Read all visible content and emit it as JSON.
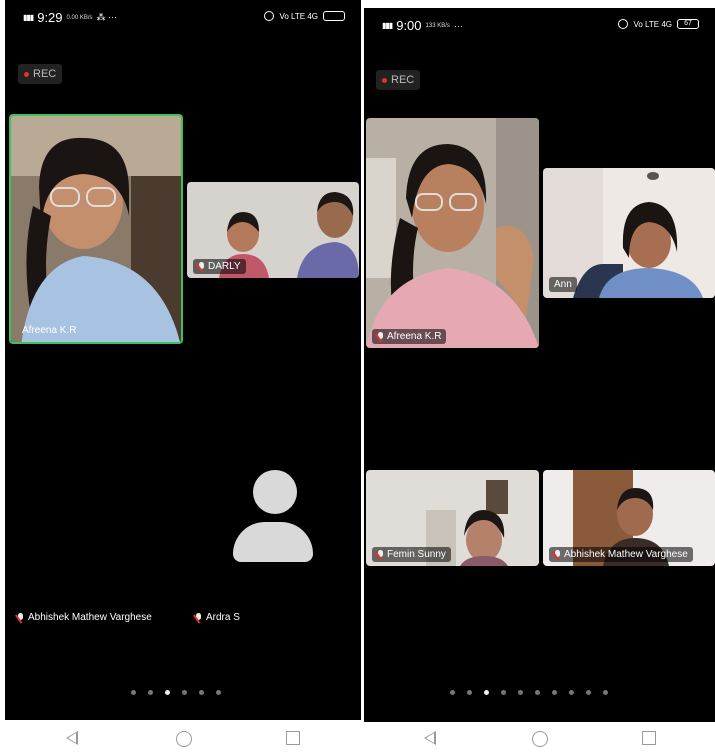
{
  "left": {
    "status": {
      "time": "9:29",
      "net": "4G",
      "speed": "0.00 KB/s",
      "extra": "⁂ ···",
      "right": "Vo LTE 4G"
    },
    "rec_label": "REC",
    "tiles": [
      {
        "name": "Afreena K.R",
        "muted": false
      },
      {
        "name": "DARLY",
        "muted": true
      }
    ],
    "audio_participants": [
      {
        "name": "Abhishek Mathew Varghese",
        "muted": true
      },
      {
        "name": "Ardra S",
        "muted": true
      }
    ],
    "page_dots": {
      "count": 6,
      "active": 2
    }
  },
  "right": {
    "status": {
      "time": "9:00",
      "net": "4G",
      "speed": "133 KB/s",
      "extra": "···",
      "right": "Vo LTE 4G",
      "battery": "67"
    },
    "rec_label": "REC",
    "tiles": [
      {
        "name": "Afreena K.R",
        "muted": true
      },
      {
        "name": "Ann",
        "muted": false
      },
      {
        "name": "Femin Sunny",
        "muted": true
      },
      {
        "name": "Abhishek Mathew Varghese",
        "muted": true
      }
    ],
    "page_dots": {
      "count": 10,
      "active": 2
    }
  },
  "accent": {
    "active_speaker": "#3fc15a",
    "rec_dot": "#e0322f"
  },
  "navbar": {
    "icons": [
      "back-icon",
      "home-icon",
      "recents-icon"
    ]
  }
}
